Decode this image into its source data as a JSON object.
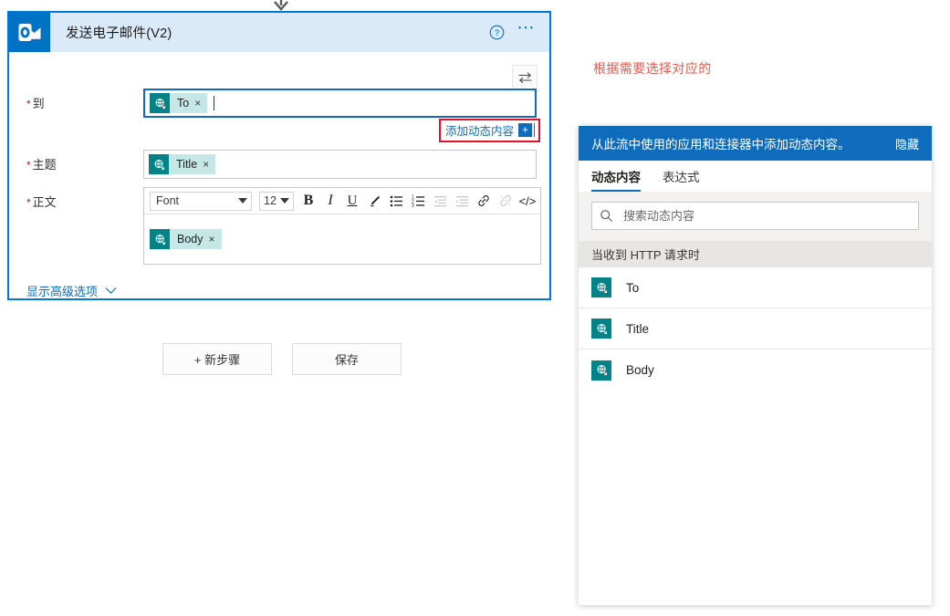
{
  "connector": {
    "arrow_icon": "arrow-down-icon"
  },
  "card": {
    "logo_icon": "outlook-icon",
    "title": "发送电子邮件(V2)",
    "help_icon": "help-circle-icon",
    "more_icon": "more-horizontal-icon",
    "swap_icon": "swap-arrows-icon",
    "fields": {
      "to": {
        "label": "到",
        "required_marker": "*",
        "tokens": [
          {
            "label": "To",
            "icon": "http-request-icon",
            "close": "×"
          }
        ]
      },
      "subject": {
        "label": "主题",
        "required_marker": "*",
        "tokens": [
          {
            "label": "Title",
            "icon": "http-request-icon",
            "close": "×"
          }
        ]
      },
      "body": {
        "label": "正文",
        "required_marker": "*",
        "tokens": [
          {
            "label": "Body",
            "icon": "http-request-icon",
            "close": "×"
          }
        ]
      }
    },
    "add_dynamic": {
      "text": "添加动态内容",
      "plus_label": "+",
      "highlight_color": "#e81123"
    },
    "rte_toolbar": {
      "font_value": "Font",
      "size_value": "12",
      "buttons": [
        {
          "name": "bold-icon",
          "glyph": "B",
          "disabled": false
        },
        {
          "name": "italic-icon",
          "glyph": "I",
          "disabled": false
        },
        {
          "name": "underline-icon",
          "glyph": "U",
          "disabled": false
        },
        {
          "name": "text-highlight-icon",
          "glyph": "",
          "disabled": false
        },
        {
          "name": "bulleted-list-icon",
          "glyph": "",
          "disabled": false
        },
        {
          "name": "numbered-list-icon",
          "glyph": "",
          "disabled": false
        },
        {
          "name": "decrease-indent-icon",
          "glyph": "",
          "disabled": true
        },
        {
          "name": "increase-indent-icon",
          "glyph": "",
          "disabled": true
        },
        {
          "name": "link-icon",
          "glyph": "",
          "disabled": false
        },
        {
          "name": "unlink-icon",
          "glyph": "",
          "disabled": true
        },
        {
          "name": "code-view-icon",
          "glyph": "</>",
          "disabled": false
        }
      ]
    },
    "advanced_options": {
      "label": "显示高级选项",
      "chevron_icon": "chevron-down-icon"
    }
  },
  "buttons": {
    "new_step": "+ 新步骤",
    "save": "保存"
  },
  "annotation": {
    "text": "根据需要选择对应的",
    "color": "#e8594a"
  },
  "dynamic_panel": {
    "header_title": "从此流中使用的应用和连接器中添加动态内容。",
    "hide_label": "隐藏",
    "header_color": "#0f6cbd",
    "tabs": [
      {
        "label": "动态内容",
        "active": true
      },
      {
        "label": "表达式",
        "active": false
      }
    ],
    "search": {
      "placeholder": "搜索动态内容",
      "value": "",
      "icon": "search-icon"
    },
    "group_header": "当收到 HTTP 请求时",
    "items": [
      {
        "label": "To",
        "icon": "http-request-icon"
      },
      {
        "label": "Title",
        "icon": "http-request-icon"
      },
      {
        "label": "Body",
        "icon": "http-request-icon"
      }
    ],
    "accent_color": "#038387"
  }
}
